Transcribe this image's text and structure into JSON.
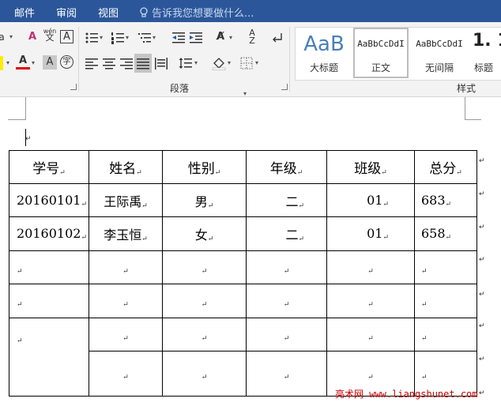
{
  "menu": {
    "items": [
      "邮件",
      "审阅",
      "视图"
    ],
    "tell_me": "告诉我您想要做什么..."
  },
  "ribbon": {
    "groups": {
      "paragraph": "段落",
      "styles": "样式"
    },
    "styles_gallery": [
      {
        "sample": "AaB",
        "name": "大标题"
      },
      {
        "sample": "AaBbCcDdI",
        "name": "正文"
      },
      {
        "sample": "AaBbCcDdI",
        "name": "无间隔"
      },
      {
        "sample": "1. 1",
        "name": "标题"
      }
    ],
    "font_pinyin_label": "wén"
  },
  "table": {
    "headers": [
      "学号",
      "姓名",
      "性别",
      "年级",
      "班级",
      "总分"
    ],
    "rows": [
      [
        "20160101",
        "王际禹",
        "男",
        "二",
        "01",
        "683"
      ],
      [
        "20160102",
        "李玉恒",
        "女",
        "二",
        "01",
        "658"
      ]
    ],
    "paragraph_mark": "↵"
  },
  "watermark": "亮术网 www.liangshunet.com",
  "colors": {
    "menubar": "#2b579a",
    "ribbon_bg": "#f3f3f3",
    "font_color_accent": "#e00000",
    "watermark": "#c80000"
  }
}
